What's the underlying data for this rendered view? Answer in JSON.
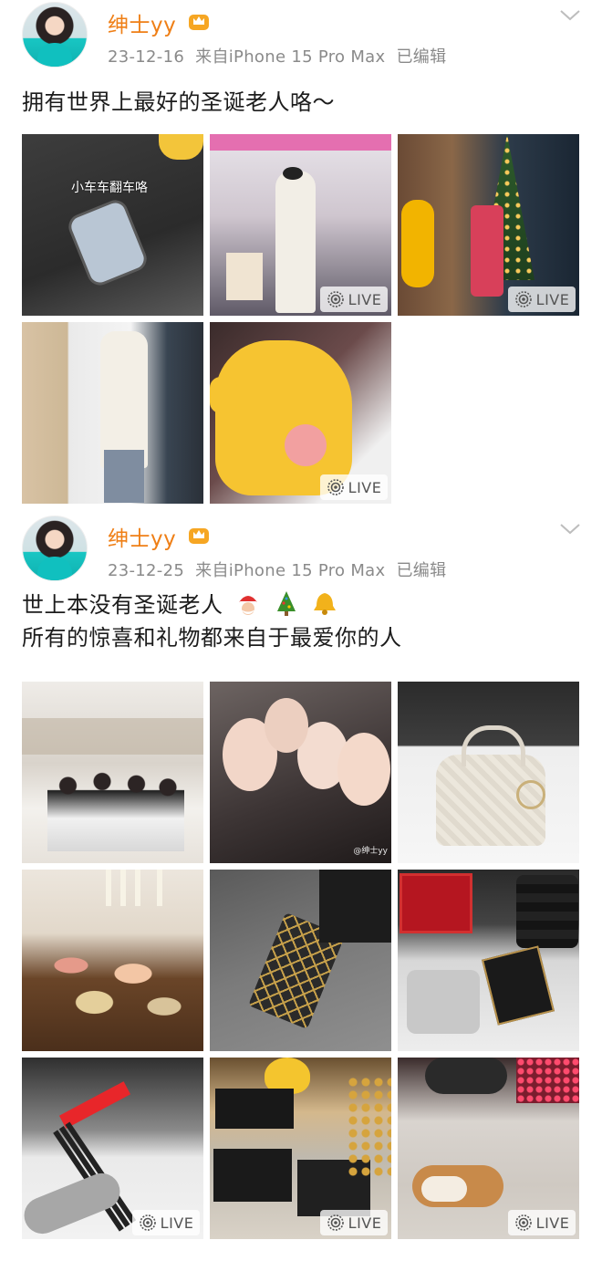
{
  "posts": [
    {
      "username": "绅士yy",
      "date": "23-12-16",
      "source": "来自iPhone 15 Pro Max",
      "edited": "已编辑",
      "text_lines": [
        "拥有世界上最好的圣诞老人咯～"
      ],
      "images": [
        {
          "caption": "小车车翻车咯",
          "live": false
        },
        {
          "live": true
        },
        {
          "live": true
        },
        {
          "live": false
        },
        {
          "live": true
        }
      ]
    },
    {
      "username": "绅士yy",
      "date": "23-12-25",
      "source": "来自iPhone 15 Pro Max",
      "edited": "已编辑",
      "text_lines": [
        "世上本没有圣诞老人",
        "所有的惊喜和礼物都来自于最爱你的人"
      ],
      "emojis": [
        "santa-emoji",
        "christmas-tree-emoji",
        "bell-emoji"
      ],
      "images": [
        {
          "live": false
        },
        {
          "watermark": "@绅士yy",
          "live": false
        },
        {
          "live": false
        },
        {
          "live": false
        },
        {
          "live": false
        },
        {
          "live": false
        },
        {
          "live": true
        },
        {
          "live": true
        },
        {
          "live": true
        }
      ]
    }
  ],
  "live_label": "LIVE",
  "colors": {
    "username": "#ef7f16",
    "meta": "#8a8a8a",
    "text": "#1c1c1c"
  }
}
